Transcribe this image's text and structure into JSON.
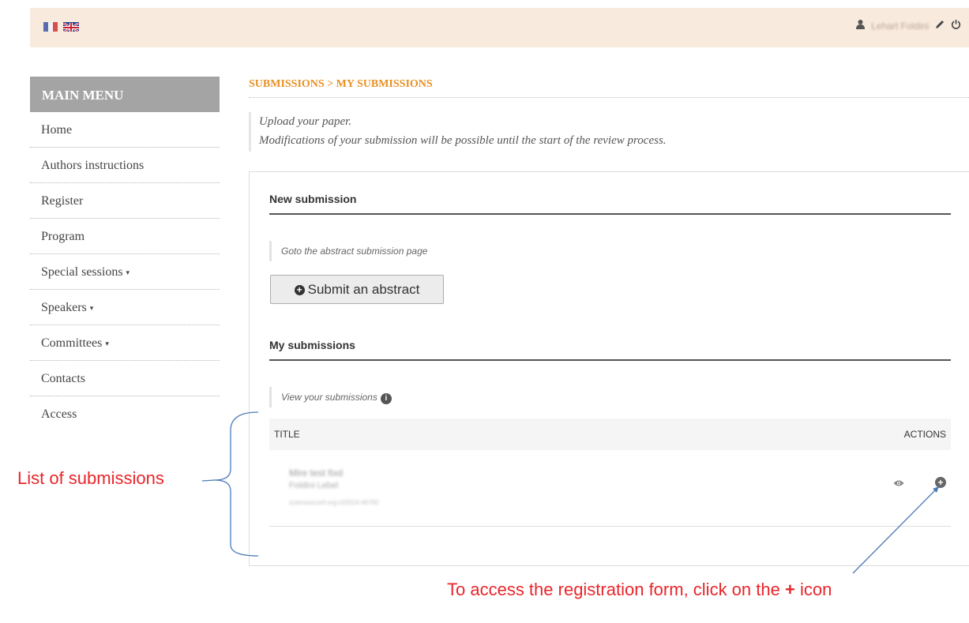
{
  "header": {
    "languages": [
      "French flag",
      "English flag"
    ],
    "user_name": "Lehart Foldini",
    "icons": [
      "user-icon",
      "pencil-icon",
      "power-icon"
    ]
  },
  "sidebar": {
    "heading": "MAIN MENU",
    "items": [
      {
        "label": "Home",
        "has_caret": false
      },
      {
        "label": "Authors instructions",
        "has_caret": false
      },
      {
        "label": "Register",
        "has_caret": false
      },
      {
        "label": "Program",
        "has_caret": false
      },
      {
        "label": "Special sessions",
        "has_caret": true
      },
      {
        "label": "Speakers",
        "has_caret": true
      },
      {
        "label": "Committees",
        "has_caret": true
      },
      {
        "label": "Contacts",
        "has_caret": false
      },
      {
        "label": "Access",
        "has_caret": false
      }
    ],
    "caret_glyph": "▾"
  },
  "main": {
    "breadcrumb": "SUBMISSIONS > MY SUBMISSIONS",
    "intro_line1": "Upload your paper.",
    "intro_line2": "Modifications of your submission will be possible until the start of the review process.",
    "new_submission": {
      "title": "New submission",
      "hint": "Goto the abstract submission page",
      "button_label": "Submit an abstract"
    },
    "my_submissions": {
      "title": "My submissions",
      "hint": "View your submissions",
      "columns": [
        "TITLE",
        "ACTIONS"
      ],
      "rows": [
        {
          "title": "Mire test fixd",
          "authors": "Foldini Lebel",
          "id": "sciencesconf.org:c02014-46760"
        }
      ]
    }
  },
  "annotations": {
    "list_label": "List of submissions",
    "plus_label_prefix": "To access the registration form, click on the ",
    "plus_label_bold": "+",
    "plus_label_suffix": " icon"
  },
  "colors": {
    "topbar_bg": "#f8eadd",
    "menu_head_bg": "#a4a4a4",
    "breadcrumb": "#e89124",
    "annotation": "#e8262b",
    "arrow": "#4a7ab5"
  }
}
